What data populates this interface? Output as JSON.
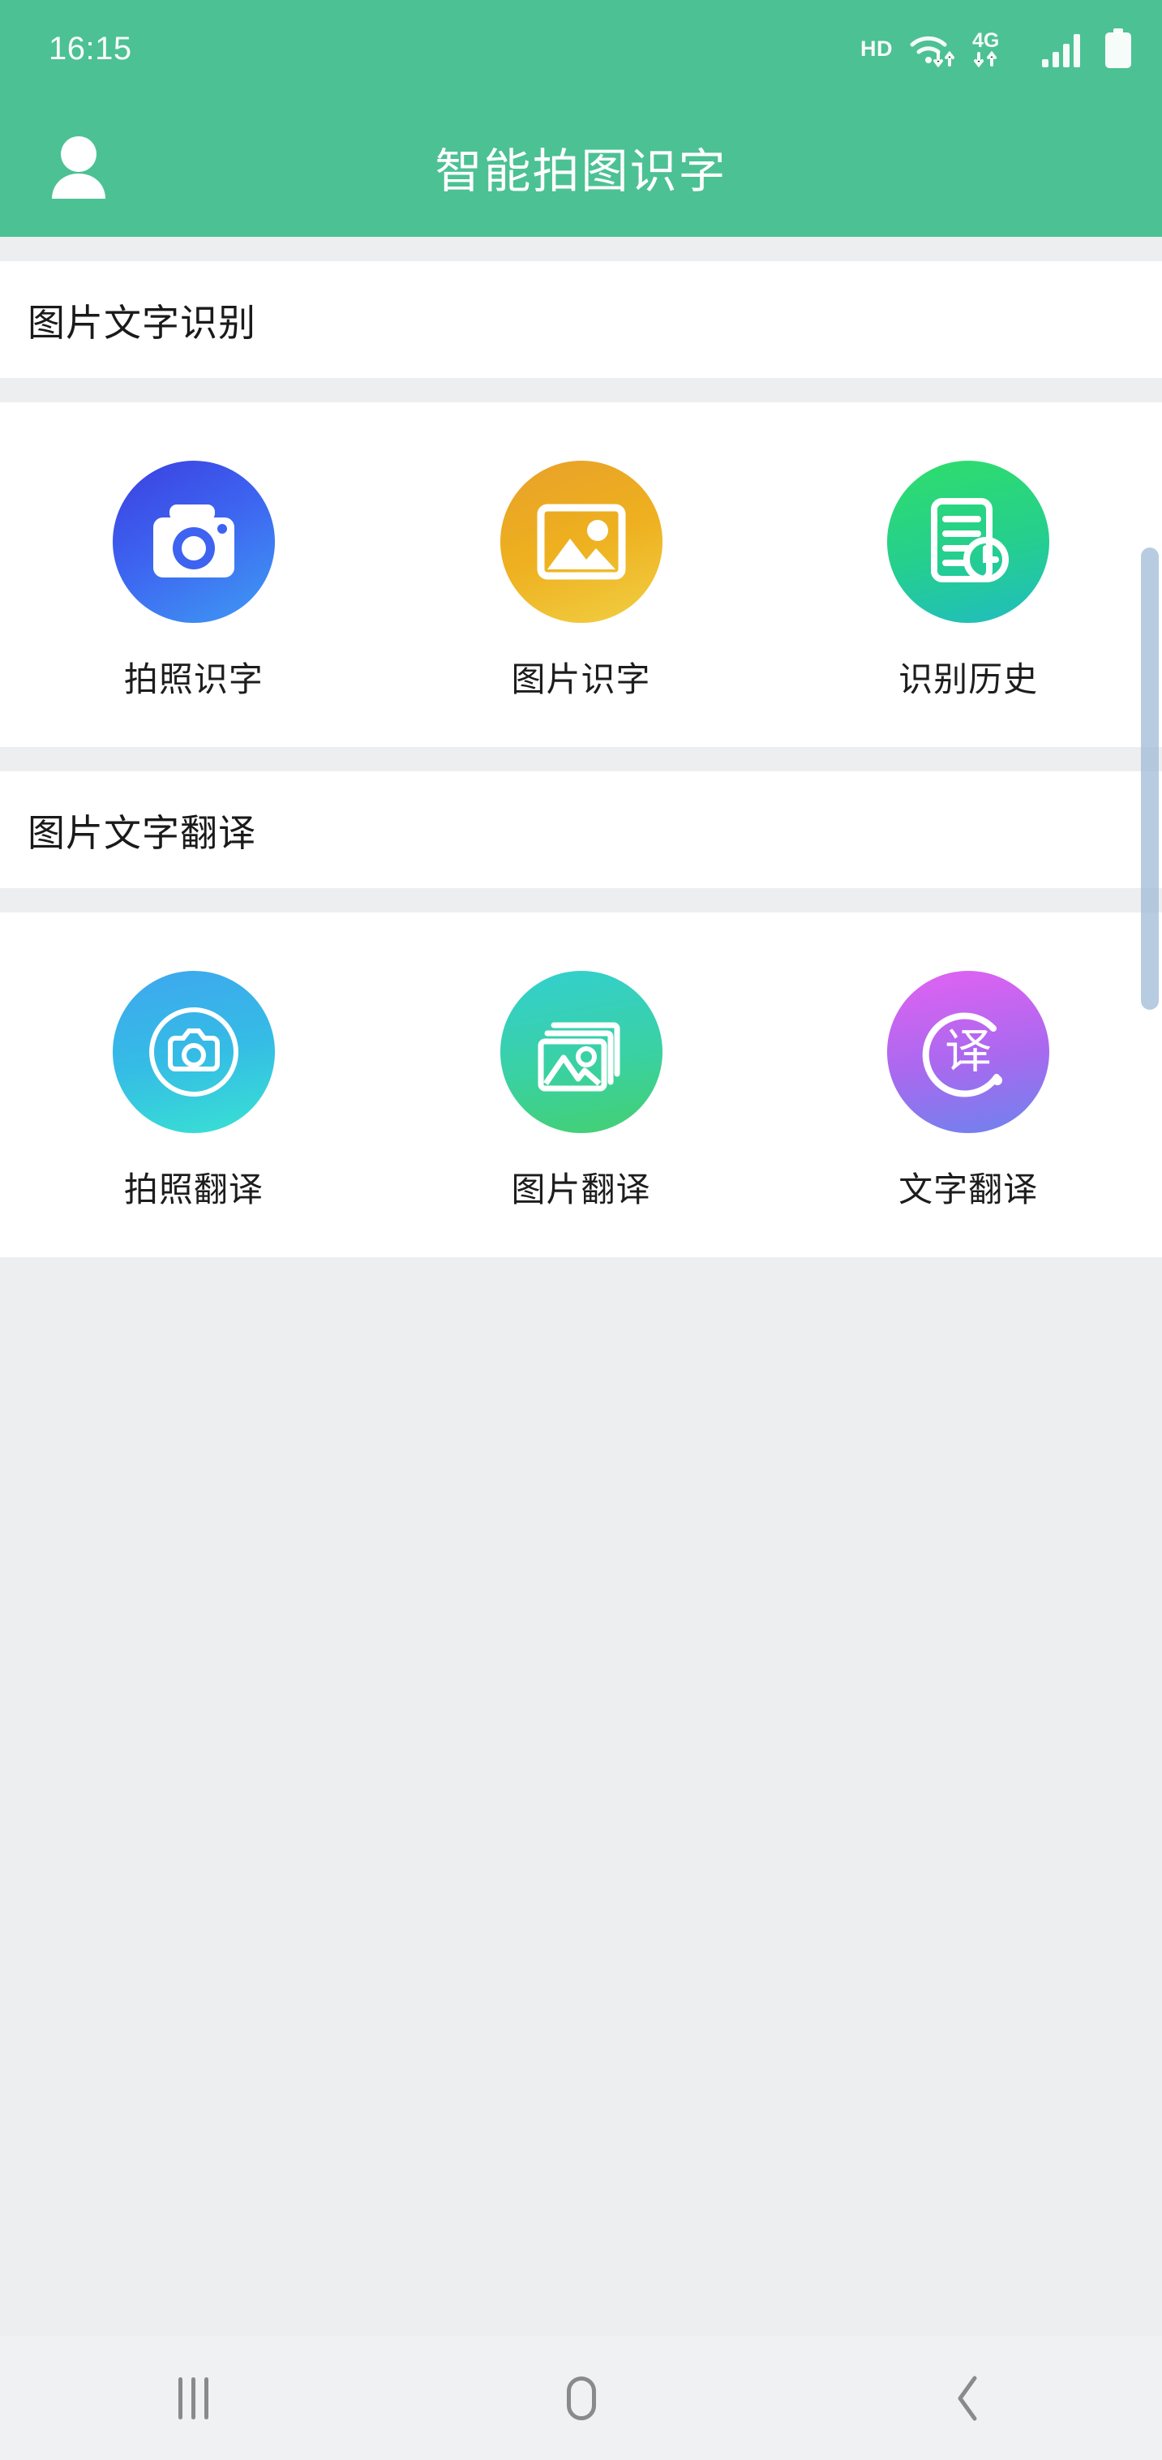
{
  "status_bar": {
    "time": "16:15",
    "hd_label": "HD",
    "network_label": "4G",
    "icons": [
      "hd-badge",
      "wifi-icon",
      "network-4g-icon",
      "signal-bars-icon",
      "battery-icon"
    ]
  },
  "app_bar": {
    "title": "智能拍图识字",
    "avatar_icon": "user-avatar-icon"
  },
  "sections": [
    {
      "id": "recognition",
      "title": "图片文字识别",
      "items": [
        {
          "label": "拍照识字",
          "icon": "camera-icon",
          "color": "#3d63f0"
        },
        {
          "label": "图片识字",
          "icon": "picture-icon",
          "color": "#eeb01f"
        },
        {
          "label": "识别历史",
          "icon": "document-clock-icon",
          "color": "#25cf8e"
        }
      ]
    },
    {
      "id": "translation",
      "title": "图片文字翻译",
      "items": [
        {
          "label": "拍照翻译",
          "icon": "camera-outline-icon",
          "color": "#35bbe6"
        },
        {
          "label": "图片翻译",
          "icon": "photo-stack-icon",
          "color": "#3ad1a4"
        },
        {
          "label": "文字翻译",
          "icon": "translate-icon",
          "color": "#a969ef"
        }
      ]
    }
  ],
  "scrollbar": {
    "visible": true
  },
  "nav_bar": {
    "recents_label": "recents-icon",
    "home_label": "home-icon",
    "back_label": "back-icon"
  },
  "theme": {
    "accent": "#4cc194",
    "page_background": "#edeef0",
    "panel_background": "#ffffff"
  }
}
